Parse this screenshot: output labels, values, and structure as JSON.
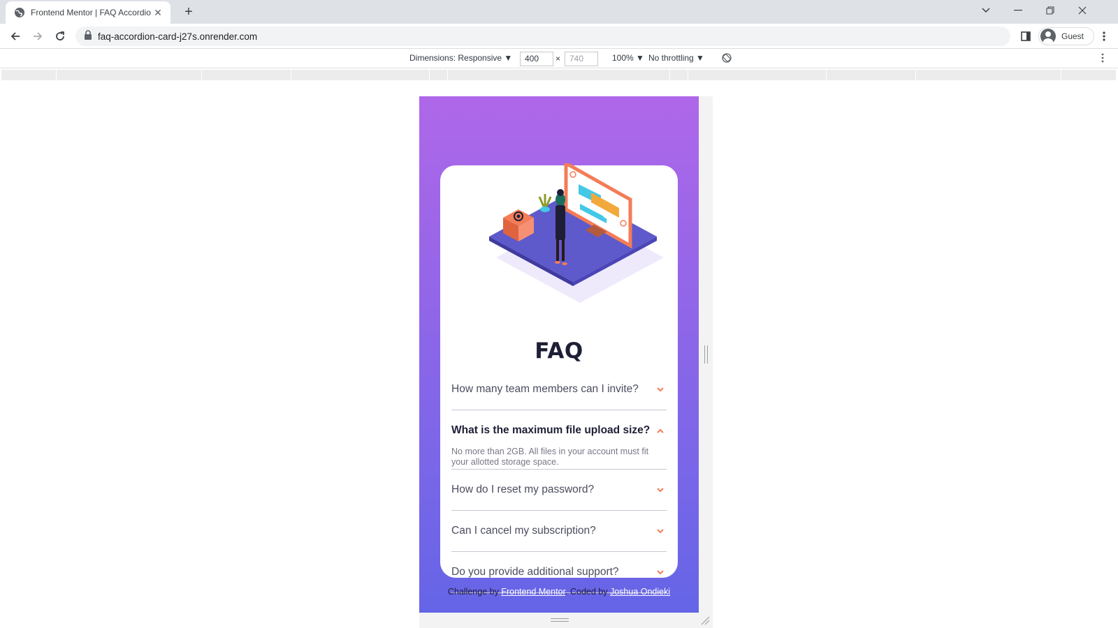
{
  "browser": {
    "tab_title": "Frontend Mentor | FAQ Accordio",
    "url": "faq-accordion-card-j27s.onrender.com",
    "profile_label": "Guest"
  },
  "devtools": {
    "dimensions_label": "Dimensions: Responsive ▼",
    "width_value": "400",
    "height_value": "740",
    "times_sign": "×",
    "zoom_label": "100% ▼",
    "throttle_label": "No throttling ▼"
  },
  "page": {
    "title": "FAQ",
    "faqs": [
      {
        "question": "How many team members can I invite?",
        "answer": "",
        "open": false
      },
      {
        "question": "What is the maximum file upload size?",
        "answer": "No more than 2GB. All files in your account must fit your allotted storage space.",
        "open": true
      },
      {
        "question": "How do I reset my password?",
        "answer": "",
        "open": false
      },
      {
        "question": "Can I cancel my subscription?",
        "answer": "",
        "open": false
      },
      {
        "question": "Do you provide additional support?",
        "answer": "",
        "open": false
      }
    ],
    "attribution": {
      "prefix": "Challenge by ",
      "link1": "Frontend Mentor",
      "middle": ". Coded by ",
      "link2": "Joshua Ondieki"
    }
  },
  "colors": {
    "gradient_start": "#af67e9",
    "gradient_end": "#6565e7",
    "arrow": "#f47c57",
    "heading": "#1e1f36"
  }
}
